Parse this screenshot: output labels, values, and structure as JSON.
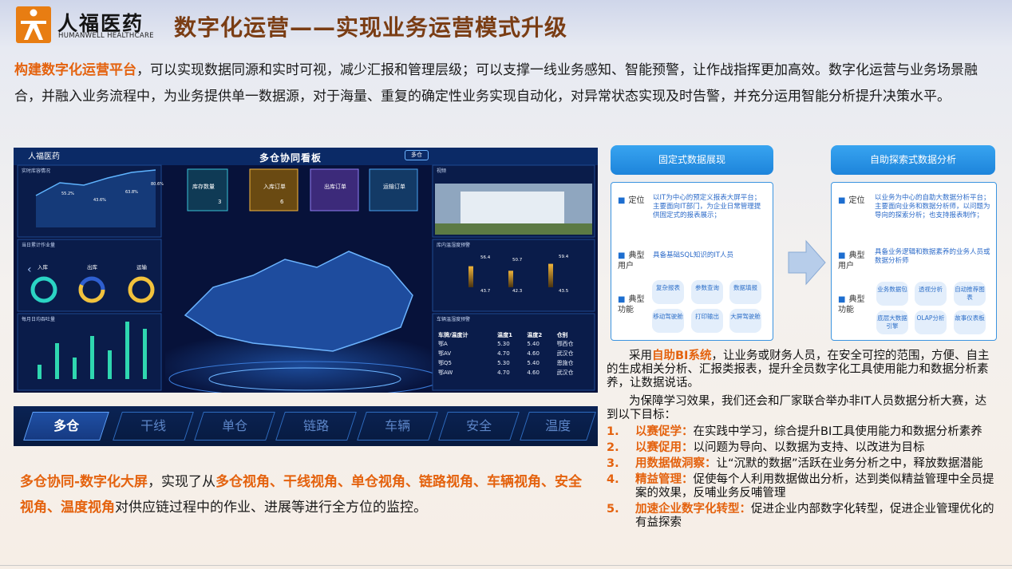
{
  "brand": {
    "name_cn": "人福医药",
    "name_en": "HUMANWELL HEALTHCARE",
    "color": "#e87d12"
  },
  "title": "数字化运营——实现业务运营模式升级",
  "intro": {
    "highlight": "构建数字化运营平台",
    "text": "，可以实现数据同源和实时可视，减少汇报和管理层级；可以支撑一线业务感知、智能预警，让作战指挥更加高效。数字化运营与业务场景融合，并融入业务流程中，为业务提供单一数据源，对于海量、重复的确定性业务实现自动化，对异常状态实现及时告警，并充分运用智能分析提升决策水平。"
  },
  "dashboard": {
    "logo": "人福医药",
    "title": "多仓协同看板",
    "nav": [
      "多仓",
      "",
      "",
      "",
      "",
      "",
      ""
    ],
    "panel_titles": {
      "trend": "实时库容情况",
      "ops": "当日累计作业量",
      "daily": "每月日均吞吐量",
      "video": "视频",
      "temp": "库内温湿度预警",
      "vehicle": "车辆温湿度预警"
    },
    "kpis": [
      {
        "label": "库存数量",
        "value": "3"
      },
      {
        "label": "入库订单",
        "value": "6"
      },
      {
        "label": "出库订单",
        "value": ""
      },
      {
        "label": "运输订单",
        "value": ""
      }
    ],
    "gauges": [
      "入库",
      "出库",
      "运输"
    ],
    "trend_values": [
      40,
      56,
      53,
      62,
      69,
      72
    ],
    "trend_labels": [
      "55.2%",
      "43.6%",
      "63.8%",
      "80.6%"
    ],
    "daily_bars": [
      2,
      5,
      3,
      6,
      4,
      8,
      7
    ],
    "temp_values": [
      {
        "top": "56.4",
        "bottom": "43.7"
      },
      {
        "top": "50.7",
        "bottom": "42.3"
      },
      {
        "top": "59.4",
        "bottom": "43.5"
      }
    ],
    "vehicle_table": {
      "headers": [
        "车牌/温度计",
        "温度1",
        "温度2",
        "仓别"
      ],
      "rows": [
        [
          "鄂A",
          "5.30",
          "5.40",
          "鄂西仓"
        ],
        [
          "鄂AV",
          "4.70",
          "4.60",
          "武汉仓"
        ],
        [
          "鄂Q5",
          "5.30",
          "5.40",
          "恩施仓"
        ],
        [
          "鄂AW",
          "4.70",
          "4.60",
          "武汉仓"
        ]
      ]
    }
  },
  "tabs": [
    "多仓",
    "干线",
    "单仓",
    "链路",
    "车辆",
    "安全",
    "温度"
  ],
  "bottom": {
    "h1": "多仓协同-数字化大屏",
    "t1": "，实现了从",
    "h2": "多仓视角、干线视角、单仓视角、链路视角、车辆视角、安全视角、温度视角",
    "t2": "对供应链过程中的作业、进展等进行全方位的监控。"
  },
  "fixed": {
    "header": "固定式数据展现",
    "rows": [
      {
        "label": "定位",
        "text": "以IT为中心的预定义报表大屏平台；主要面向IT部门，为企业日常管理提供固定式的报表展示；"
      },
      {
        "label": "典型用户",
        "text": "具备基础SQL知识的IT人员"
      },
      {
        "label": "典型功能",
        "text": ""
      }
    ],
    "pills": [
      "复杂报表",
      "参数查询",
      "数据填报",
      "移动驾驶舱",
      "打印输出",
      "大屏驾驶舱"
    ]
  },
  "explore": {
    "header": "自助探索式数据分析",
    "rows": [
      {
        "label": "定位",
        "text": "以业务为中心的自助大数据分析平台；主要面向业务和数据分析师，以问题为导向的探索分析；也支持报表制作；"
      },
      {
        "label": "典型用户",
        "text": "具备业务逻辑和数据素养的业务人员或数据分析师"
      },
      {
        "label": "典型功能",
        "text": ""
      }
    ],
    "pills": [
      "业务数据包",
      "透视分析",
      "自动推荐图表",
      "底层大数据引擎",
      "OLAP分析",
      "故事仪表板"
    ]
  },
  "bi": {
    "p1a": "采用",
    "p1h": "自助BI系统",
    "p1b": "，让业务或财务人员，在安全可控的范围，方便、自主的生成相关分析、汇报类报表，提升全员数字化工具使用能力和数据分析素养，让数据说话。",
    "p2": "为保障学习效果，我们还会和厂家联合举办非IT人员数据分析大赛，达到以下目标："
  },
  "goals": [
    {
      "num": "1.",
      "head": "以赛促学：",
      "text": "在实践中学习，综合提升BI工具使用能力和数据分析素养"
    },
    {
      "num": "2.",
      "head": "以赛促用：",
      "text": "以问题为导向、以数据为支持、以改进为目标"
    },
    {
      "num": "3.",
      "head": "用数据做洞察：",
      "text": "让“沉默的数据”活跃在业务分析之中，释放数据潜能"
    },
    {
      "num": "4.",
      "head": "精益管理：",
      "text": "促使每个人利用数据做出分析，达到类似精益管理中全员提案的效果，反哺业务反哺管理"
    },
    {
      "num": "5.",
      "head": "加速企业数字化转型：",
      "text": "促进企业内部数字化转型，促进企业管理优化的有益探索"
    }
  ]
}
